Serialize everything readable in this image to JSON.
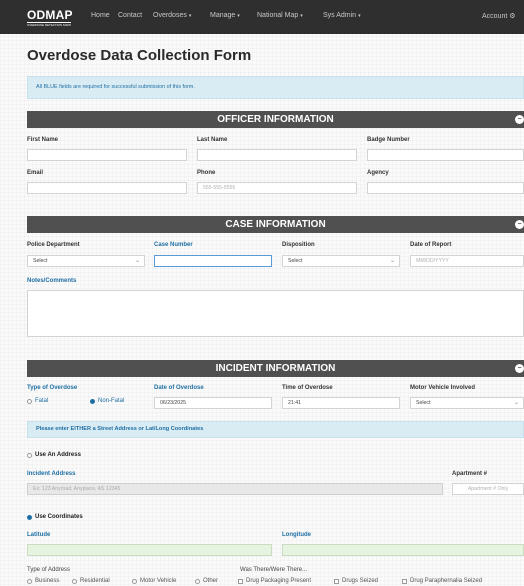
{
  "nav": {
    "logo": "ODMAP",
    "logo_sub": "OVERDOSE DETECTION MAPPING",
    "items": [
      {
        "label": "Home",
        "caret": ""
      },
      {
        "label": "Contact",
        "caret": ""
      },
      {
        "label": "Overdoses",
        "caret": "▾"
      },
      {
        "label": "Manage",
        "caret": "▾"
      },
      {
        "label": "National Map",
        "caret": "▾"
      },
      {
        "label": "Sys Admin",
        "caret": "▾"
      }
    ],
    "account": "Account",
    "account_icon": "gear-icon"
  },
  "page_title": "Overdose Data Collection Form",
  "notice": "All BLUE fields are required for successful submission of this form.",
  "officer": {
    "heading": "OFFICER INFORMATION",
    "first_name_label": "First Name",
    "last_name_label": "Last Name",
    "badge_label": "Badge Number",
    "email_label": "Email",
    "phone_label": "Phone",
    "phone_placeholder": "555-555-5555",
    "agency_label": "Agency"
  },
  "case": {
    "heading": "CASE INFORMATION",
    "police_dept_label": "Police Department",
    "police_dept_value": "Select",
    "case_number_label": "Case Number",
    "disposition_label": "Disposition",
    "disposition_value": "Select",
    "date_report_label": "Date of Report",
    "date_report_placeholder": "MM/DD/YYYY",
    "notes_label": "Notes/Comments"
  },
  "incident": {
    "heading": "INCIDENT INFORMATION",
    "type_label": "Type of Overdose",
    "type_fatal": "Fatal",
    "type_nonfatal": "Non-Fatal",
    "date_label": "Date of Overdose",
    "date_value": "06/23/2025",
    "time_label": "Time of Overdose",
    "time_value": "21:41",
    "mv_label": "Motor Vehicle Involved",
    "mv_value": "Select",
    "address_hint": "Please enter EITHER a Street Address or Lat/Long Coordinates",
    "use_address": "Use An Address",
    "incident_address_label": "Incident Address",
    "incident_address_placeholder": "Ex: 123 Anyroad, Anyplace, AS 12345",
    "apartment_label": "Apartment #",
    "apartment_placeholder": "Apartment # Only",
    "use_coordinates": "Use Coordinates",
    "latitude_label": "Latitude",
    "longitude_label": "Longitude",
    "type_address_label": "Type of Address",
    "address_types": [
      "Business",
      "Residential",
      "Motor Vehicle",
      "Other"
    ],
    "was_there_label": "Was There/Were There...",
    "was_there_items": [
      "Drug Packaging Present",
      "Drugs Seized",
      "Drug Paraphernalia Seized"
    ]
  },
  "colors": {
    "nav_bg": "#2f2f2f",
    "section_bg": "#505050",
    "required_blue": "#1f6fa3",
    "notice_bg": "#d9ecf4",
    "coord_green": "#e6f3e1"
  }
}
